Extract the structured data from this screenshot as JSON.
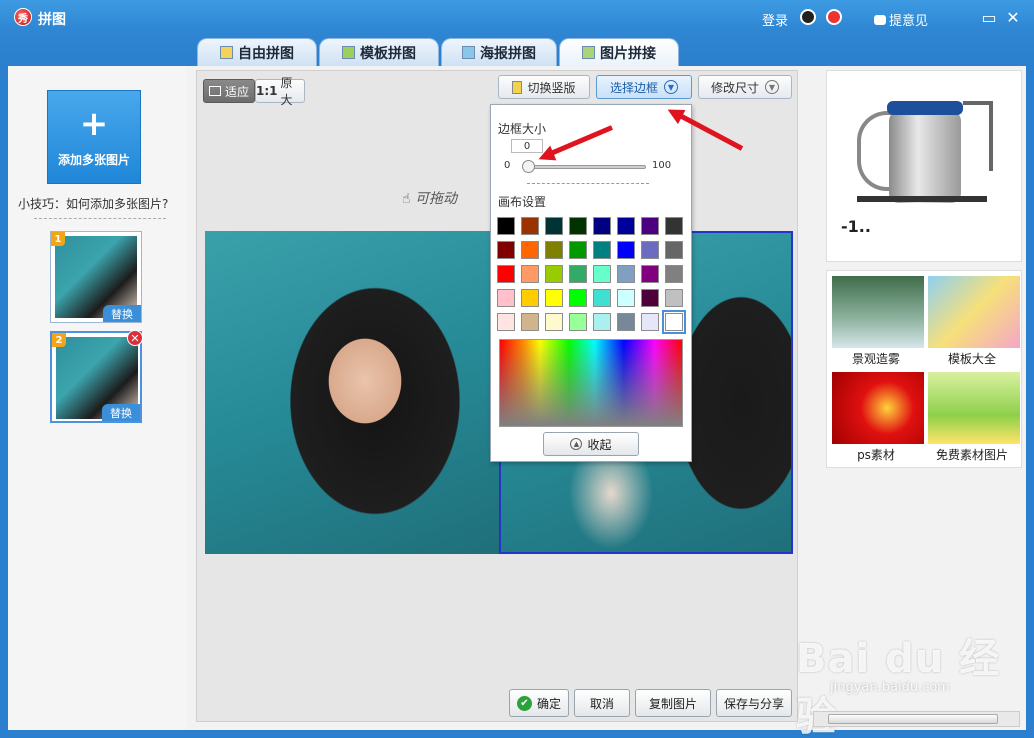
{
  "window": {
    "title": "拼图",
    "app_icon": "秀"
  },
  "titlebar": {
    "login": "登录",
    "feedback": "提意见",
    "minimize": "▭",
    "close": "✕"
  },
  "tabs": [
    {
      "label": "自由拼图"
    },
    {
      "label": "模板拼图"
    },
    {
      "label": "海报拼图"
    },
    {
      "label": "图片拼接"
    }
  ],
  "left_panel": {
    "add_button": "添加多张图片",
    "tip": "小技巧：如何添加多张图片?",
    "thumbs": [
      {
        "num": "1",
        "replace": "替换"
      },
      {
        "num": "2",
        "replace": "替换"
      }
    ]
  },
  "toolbar": {
    "fit": "适应",
    "original_prefix": "1:1",
    "original": "原大",
    "toggle_vertical": "切换竖版",
    "choose_border": "选择边框",
    "resize": "修改尺寸"
  },
  "canvas": {
    "drag_hint": "可拖动"
  },
  "border_popup": {
    "size_label": "边框大小",
    "value": "0",
    "min": "0",
    "max": "100",
    "slider_fraction": 0.0,
    "canvas_label": "画布设置",
    "collapse": "收起",
    "swatches": [
      "#000000",
      "#993300",
      "#003333",
      "#003300",
      "#000080",
      "#000099",
      "#4b0082",
      "#333333",
      "#800000",
      "#ff6600",
      "#808000",
      "#009900",
      "#008080",
      "#0000ff",
      "#6b6bc0",
      "#666666",
      "#ff0000",
      "#ff9966",
      "#99cc00",
      "#33aa66",
      "#66ffcc",
      "#7fa0c0",
      "#800080",
      "#808080",
      "#ffc0cb",
      "#ffcc00",
      "#ffff00",
      "#00ff00",
      "#40e0d0",
      "#ccffff",
      "#4d0039",
      "#c0c0c0",
      "#ffe4e1",
      "#d2b48c",
      "#fffacd",
      "#99ff99",
      "#aaf0ee",
      "#778899",
      "#e6e6fa",
      "#ffffff"
    ]
  },
  "bottom": {
    "ok": "确定",
    "cancel": "取消",
    "copy": "复制图片",
    "save_share": "保存与分享"
  },
  "right_panel": {
    "ad_text": "-1..",
    "grid": [
      {
        "label": "景观造雾"
      },
      {
        "label": "模板大全"
      },
      {
        "label": "ps素材"
      },
      {
        "label": "免费素材图片"
      }
    ]
  },
  "watermark": {
    "brand": "Bai du 经验",
    "url": "jingyan.baidu.com"
  },
  "colors": {
    "accent": "#2b7fcd",
    "arrow": "#e0141e",
    "selection_border": "#2433c8"
  }
}
